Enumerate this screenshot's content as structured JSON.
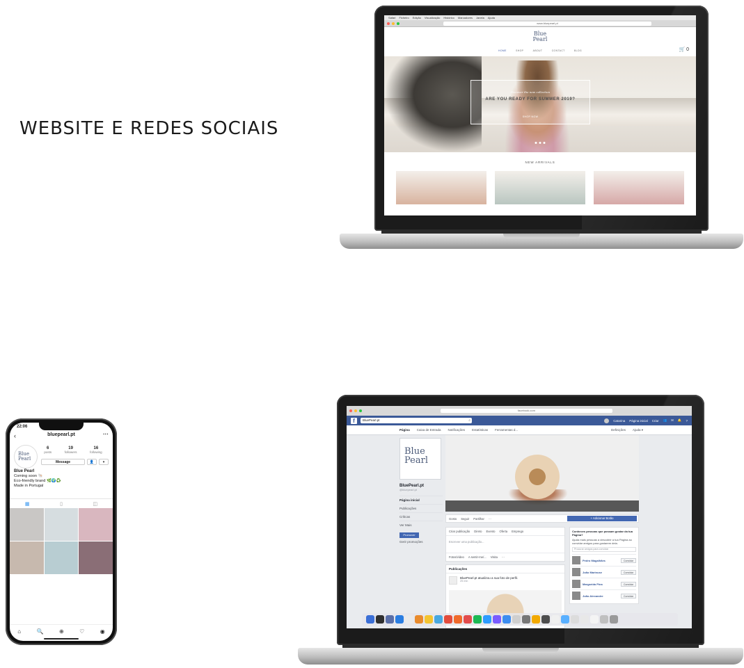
{
  "headline": "WEBSITE E REDES SOCIAIS",
  "website": {
    "menubar": [
      "Safari",
      "Ficheiro",
      "Edição",
      "Visualização",
      "Histórico",
      "Marcadores",
      "Janela",
      "Ajuda"
    ],
    "url": "www.bluepearl.pt",
    "logo_line1": "Blue",
    "logo_line2": "Pearl",
    "nav": [
      "HOME",
      "SHOP",
      "ABOUT",
      "CONTACT",
      "BLOG"
    ],
    "cart": "🛒 0",
    "hero_small": "Discover the new collection",
    "hero_title": "ARE YOU READY FOR SUMMER 2019?",
    "hero_link": "SHOP NOW",
    "section_title": "NEW ARRIVALS",
    "arrival_colors": [
      "#d8b39f",
      "#b9c6c0",
      "#d6a8a7"
    ]
  },
  "facebook": {
    "url": "facebook.com",
    "search_value": "BluePearl.pt",
    "top_right": [
      "Catarina",
      "Página inicial",
      "Criar"
    ],
    "tabs": [
      "Página",
      "Caixa de Entrada",
      "Notificações",
      "Estatísticas",
      "Ferramentas d..."
    ],
    "tabs_right": [
      "Definições",
      "Ajuda ▾"
    ],
    "logo_line1": "Blue",
    "logo_line2": "Pearl",
    "page_name": "BluePearl.pt",
    "handle": "@bluepearl.pt",
    "side_items": [
      "Página inicial",
      "Publicações",
      "Críticas",
      "Ver Mais"
    ],
    "promote": "Promover",
    "manage_promotions": "Gerir promoções",
    "actions": [
      "Gosto",
      "Seguir",
      "Partilhar",
      "···"
    ],
    "cta": "+ Adicionar Botão",
    "post_tabs": [
      "Criar publicação",
      "Direto",
      "Evento",
      "Oferta",
      "Emprego"
    ],
    "composer_placeholder": "Escrever uma publicação...",
    "post_options": [
      "Fotos/vídeo",
      "A sentir-me/...",
      "Visita",
      "···"
    ],
    "feed_header": "Publicações",
    "feed_post": "BluePearl.pt atualizou a sua foto de perfil.",
    "feed_time": "25 min",
    "invite_title": "Conheces pessoas que possam gostar da tua Página?",
    "invite_text": "Ajuda mais pessoas a descobrir a tua Página ao convidar amigos para gostarem dela.",
    "invite_search": "Procurar amigos para convidar",
    "friends": [
      "Pedro Magalhães",
      "João Marinuse",
      "Margarida Pina",
      "João Alexandre"
    ],
    "invite_button": "Convidar",
    "dock_colors": [
      "#3b6fd6",
      "#2f2f2f",
      "#5a6fa8",
      "#2a7de1",
      "#eaeaea",
      "#e98b2c",
      "#f4c430",
      "#48a8e0",
      "#e34c3c",
      "#f06a2b",
      "#e24c4c",
      "#1db954",
      "#2e9cff",
      "#7a5cff",
      "#3c8df0",
      "#cfcfcf",
      "#777777",
      "#f2a900",
      "#4d4d4d",
      "#f0f0f0",
      "#5ab0ff",
      "#dcdcdc",
      "#e8e8e8",
      "#f4f4f4",
      "#c0c0c0",
      "#9a9a9a"
    ]
  },
  "instagram": {
    "time": "22:06",
    "username": "bluepearl.pt",
    "logo_line1": "Blue",
    "logo_line2": "Pearl",
    "stats": [
      {
        "value": "6",
        "label": "posts"
      },
      {
        "value": "19",
        "label": "followers"
      },
      {
        "value": "16",
        "label": "following"
      }
    ],
    "message_button": "Message",
    "bio_name": "Blue Pearl",
    "bio_lines": [
      "Coming soon 🐚",
      "Eco-friendly brand 🌿🌍♻️",
      "Made in Portugal"
    ],
    "grid_colors": [
      "#c9c7c5",
      "#d6dde0",
      "#d9b7bf",
      "#c7b9ae",
      "#b8cdd2",
      "#8a6e76"
    ],
    "bottom_icons": [
      "⌂",
      "🔍",
      "⊕",
      "♡",
      "◉"
    ]
  }
}
